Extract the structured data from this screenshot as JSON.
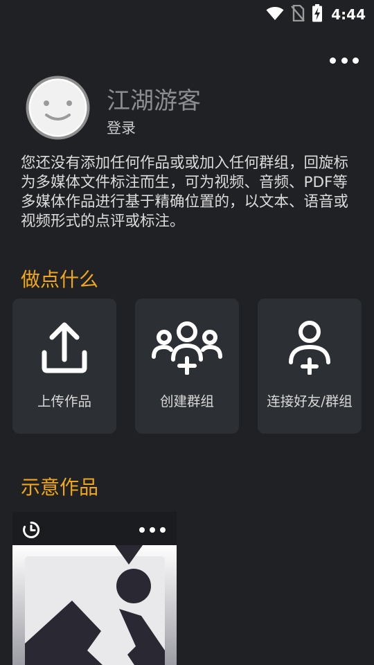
{
  "status_bar": {
    "time": "4:44",
    "icons": [
      "wifi-icon",
      "no-sim-icon",
      "battery-charging-icon"
    ]
  },
  "header": {
    "menu_icon": "more-horizontal-icon"
  },
  "profile": {
    "avatar_icon": "smiley-face-icon",
    "name": "江湖游客",
    "login_label": "登录"
  },
  "intro": {
    "text": "您还没有添加任何作品或或加入任何群组，回旋标为多媒体文件标注而生，可为视频、音频、PDF等多媒体作品进行基于精确位置的，以文本、语音或视频形式的点评或标注。"
  },
  "do_something": {
    "title": "做点什么",
    "actions": [
      {
        "icon": "upload-icon",
        "label": "上传作品"
      },
      {
        "icon": "create-group-icon",
        "label": "创建群组"
      },
      {
        "icon": "add-user-icon",
        "label": "连接好友/群组"
      }
    ]
  },
  "demo_works": {
    "title": "示意作品",
    "items": [
      {
        "type_icon": "clock-icon",
        "menu_icon": "more-horizontal-icon",
        "thumbnail_icon": "image-placeholder-icon"
      }
    ]
  },
  "colors": {
    "background": "#202124",
    "card": "#2c2f33",
    "accent": "#f2a71b",
    "text": "#dcdcdc",
    "muted": "#8a8d91"
  }
}
